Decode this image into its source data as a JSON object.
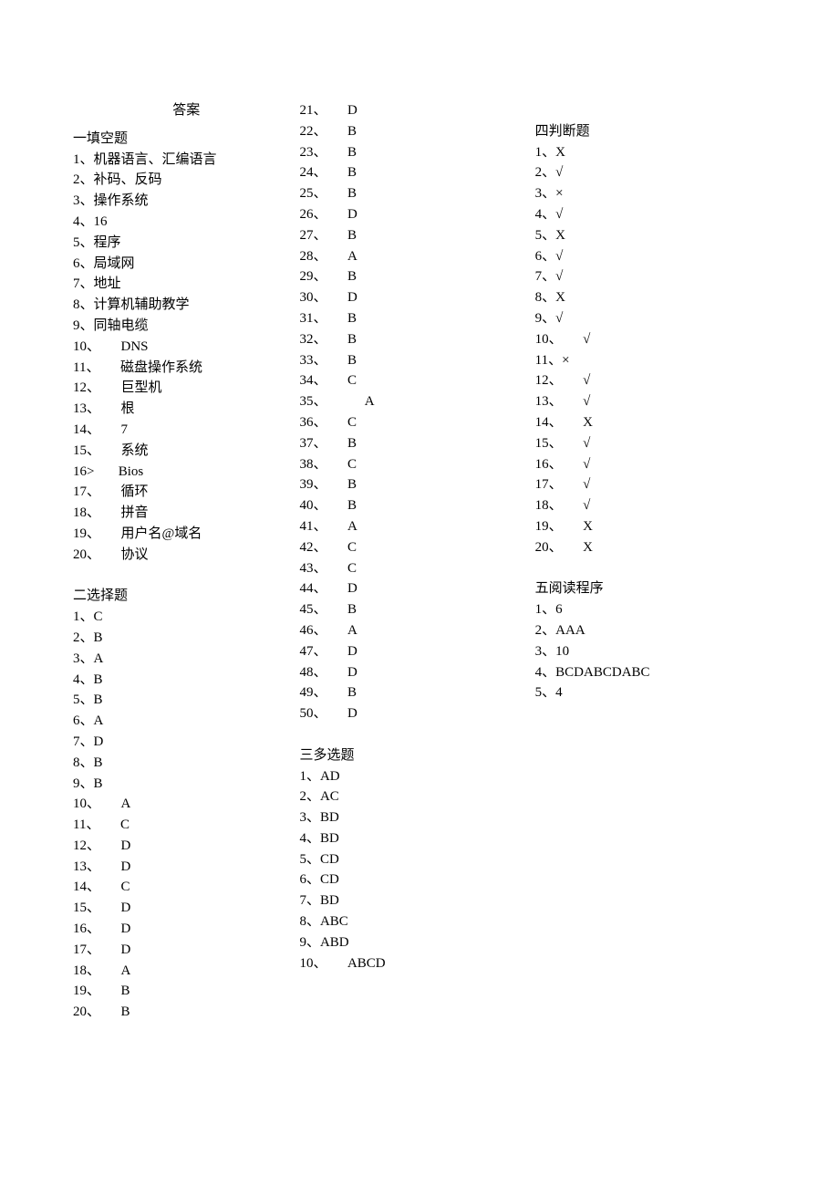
{
  "title": "答案",
  "sec1": {
    "head": "一填空题",
    "items": [
      "1、机器语言、汇编语言",
      "2、补码、反码",
      "3、操作系统",
      "4、16",
      "5、程序",
      "6、局域网",
      "7、地址",
      "8、计算机辅助教学",
      "9、同轴电缆",
      "10、      DNS",
      "11、      磁盘操作系统",
      "12、      巨型机",
      "13、      根",
      "14、      7",
      "15、      系统",
      "16>       Bios",
      "17、      循环",
      "18、      拼音",
      "19、      用户名@域名",
      "20、      协议"
    ]
  },
  "sec2": {
    "head": "二选择题",
    "items": [
      "1、C",
      "2、B",
      "3、A",
      "4、B",
      "5、B",
      "6、A",
      "7、D",
      "8、B",
      "9、B",
      "10、      A",
      "11、      C",
      "12、      D",
      "13、      D",
      "14、      C",
      "15、      D",
      "16、      D",
      "17、      D",
      "18、      A",
      "19、      B",
      "20、      B"
    ]
  },
  "sec2b": {
    "items": [
      "21、      D",
      "22、      B",
      "23、      B",
      "24、      B",
      "25、      B",
      "26、      D",
      "27、      B",
      "28、      A",
      "29、      B",
      "30、      D",
      "31、      B",
      "32、      B",
      "33、      B",
      "34、      C",
      "",
      "35、           A",
      "36、      C",
      "37、      B",
      "38、      C",
      "39、      B",
      "40、      B",
      "41、      A",
      "42、      C",
      "43、      C",
      "44、      D",
      "45、      B",
      "46、      A",
      "47、      D",
      "48、      D",
      "49、      B",
      "50、      D"
    ]
  },
  "sec3": {
    "head": "三多选题",
    "items": [
      "1、AD",
      "2、AC",
      "3、BD",
      "4、BD",
      "5、CD",
      "6、CD",
      "7、BD",
      "8、ABC",
      "9、ABD",
      "10、      ABCD"
    ]
  },
  "sec4": {
    "head": "四判断题",
    "items": [
      "1、X",
      "2、√",
      "3、×",
      "4、√",
      "5、X",
      "6、√",
      "7、√",
      "8、X",
      "9、√",
      "10、      √",
      "11、×",
      "12、      √",
      "13、      √",
      "14、      X",
      "15、      √",
      "16、      √",
      "17、      √",
      "18、      √",
      "19、      X",
      "20、      X"
    ]
  },
  "sec5": {
    "head": "五阅读程序",
    "items": [
      "1、6",
      "2、AAA",
      "3、10",
      "4、BCDABCDABC",
      "5、4"
    ]
  }
}
